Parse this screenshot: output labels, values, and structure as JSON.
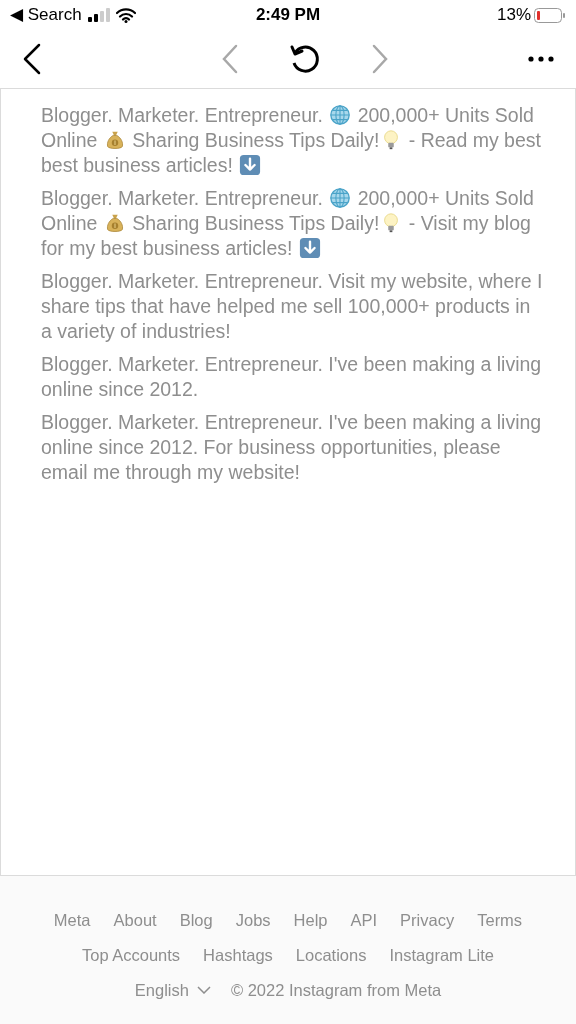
{
  "status_bar": {
    "back_label": "◀ Search",
    "time": "2:49 PM",
    "battery": "13%"
  },
  "bios": [
    {
      "parts": [
        {
          "kind": "text",
          "text": "Blogger. Marketer. Entrepreneur. "
        },
        {
          "kind": "globe"
        },
        {
          "kind": "text",
          "text": " 200,000+ Units Sold Online "
        },
        {
          "kind": "moneybag"
        },
        {
          "kind": "text",
          "text": " Sharing Business Tips Daily!"
        },
        {
          "kind": "bulb"
        },
        {
          "kind": "text",
          "text": " - Read my best best business articles! "
        },
        {
          "kind": "downarrow"
        }
      ]
    },
    {
      "parts": [
        {
          "kind": "text",
          "text": "Blogger. Marketer. Entrepreneur. "
        },
        {
          "kind": "globe"
        },
        {
          "kind": "text",
          "text": " 200,000+ Units Sold Online "
        },
        {
          "kind": "moneybag"
        },
        {
          "kind": "text",
          "text": " Sharing Business Tips Daily!"
        },
        {
          "kind": "bulb"
        },
        {
          "kind": "text",
          "text": " - Visit my blog for my best business articles! "
        },
        {
          "kind": "downarrow"
        }
      ]
    },
    {
      "parts": [
        {
          "kind": "text",
          "text": "Blogger. Marketer. Entrepreneur. Visit my website, where I share tips that have helped me sell 100,000+ products in a variety of industries!"
        }
      ]
    },
    {
      "parts": [
        {
          "kind": "text",
          "text": "Blogger. Marketer. Entrepreneur. I've been making a living online since 2012."
        }
      ]
    },
    {
      "parts": [
        {
          "kind": "text",
          "text": "Blogger. Marketer. Entrepreneur. I've been making a living online since 2012. For business opportunities, please email me through my website!"
        }
      ]
    }
  ],
  "footer": {
    "links": [
      [
        "Meta",
        "About",
        "Blog",
        "Jobs",
        "Help",
        "API",
        "Privacy",
        "Terms"
      ],
      [
        "Top Accounts",
        "Hashtags",
        "Locations",
        "Instagram Lite"
      ]
    ],
    "language": "English",
    "copyright": "© 2022 Instagram from Meta"
  }
}
